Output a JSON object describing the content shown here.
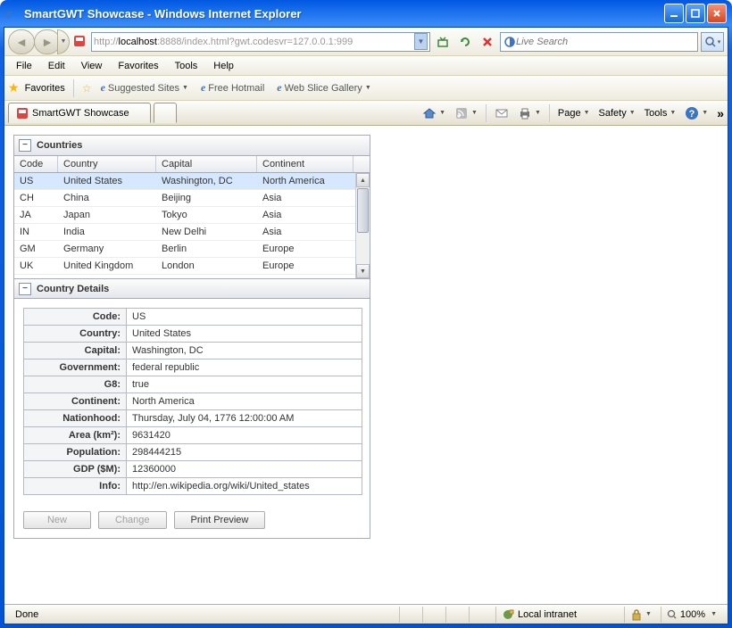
{
  "titlebar": {
    "text": "SmartGWT Showcase - Windows Internet Explorer"
  },
  "url": {
    "prefix": "http://",
    "host": "localhost",
    "suffix": ":8888/index.html?gwt.codesvr=127.0.0.1:999"
  },
  "search": {
    "placeholder": "Live Search"
  },
  "menu": {
    "file": "File",
    "edit": "Edit",
    "view": "View",
    "favorites": "Favorites",
    "tools": "Tools",
    "help": "Help"
  },
  "favbar": {
    "favorites": "Favorites",
    "suggested": "Suggested Sites",
    "hotmail": "Free Hotmail",
    "slice": "Web Slice Gallery"
  },
  "tab": {
    "title": "SmartGWT Showcase"
  },
  "cmdbar": {
    "page": "Page",
    "safety": "Safety",
    "tools": "Tools"
  },
  "section1": {
    "title": "Countries"
  },
  "grid": {
    "headers": {
      "code": "Code",
      "country": "Country",
      "capital": "Capital",
      "continent": "Continent"
    },
    "rows": [
      {
        "code": "US",
        "country": "United States",
        "capital": "Washington, DC",
        "continent": "North America",
        "sel": true
      },
      {
        "code": "CH",
        "country": "China",
        "capital": "Beijing",
        "continent": "Asia"
      },
      {
        "code": "JA",
        "country": "Japan",
        "capital": "Tokyo",
        "continent": "Asia"
      },
      {
        "code": "IN",
        "country": "India",
        "capital": "New Delhi",
        "continent": "Asia"
      },
      {
        "code": "GM",
        "country": "Germany",
        "capital": "Berlin",
        "continent": "Europe"
      },
      {
        "code": "UK",
        "country": "United Kingdom",
        "capital": "London",
        "continent": "Europe"
      }
    ]
  },
  "section2": {
    "title": "Country Details"
  },
  "details": {
    "rows": [
      {
        "label": "Code:",
        "value": "US"
      },
      {
        "label": "Country:",
        "value": "United States"
      },
      {
        "label": "Capital:",
        "value": "Washington, DC"
      },
      {
        "label": "Government:",
        "value": "federal republic"
      },
      {
        "label": "G8:",
        "value": "true"
      },
      {
        "label": "Continent:",
        "value": "North America"
      },
      {
        "label": "Nationhood:",
        "value": "Thursday, July 04, 1776 12:00:00 AM"
      },
      {
        "label": "Area (km²):",
        "value": "9631420"
      },
      {
        "label": "Population:",
        "value": "298444215"
      },
      {
        "label": "GDP ($M):",
        "value": "12360000"
      },
      {
        "label": "Info:",
        "value": "http://en.wikipedia.org/wiki/United_states"
      }
    ]
  },
  "buttons": {
    "new": "New",
    "change": "Change",
    "preview": "Print Preview"
  },
  "status": {
    "done": "Done",
    "zone": "Local intranet",
    "zoom": "100%"
  }
}
